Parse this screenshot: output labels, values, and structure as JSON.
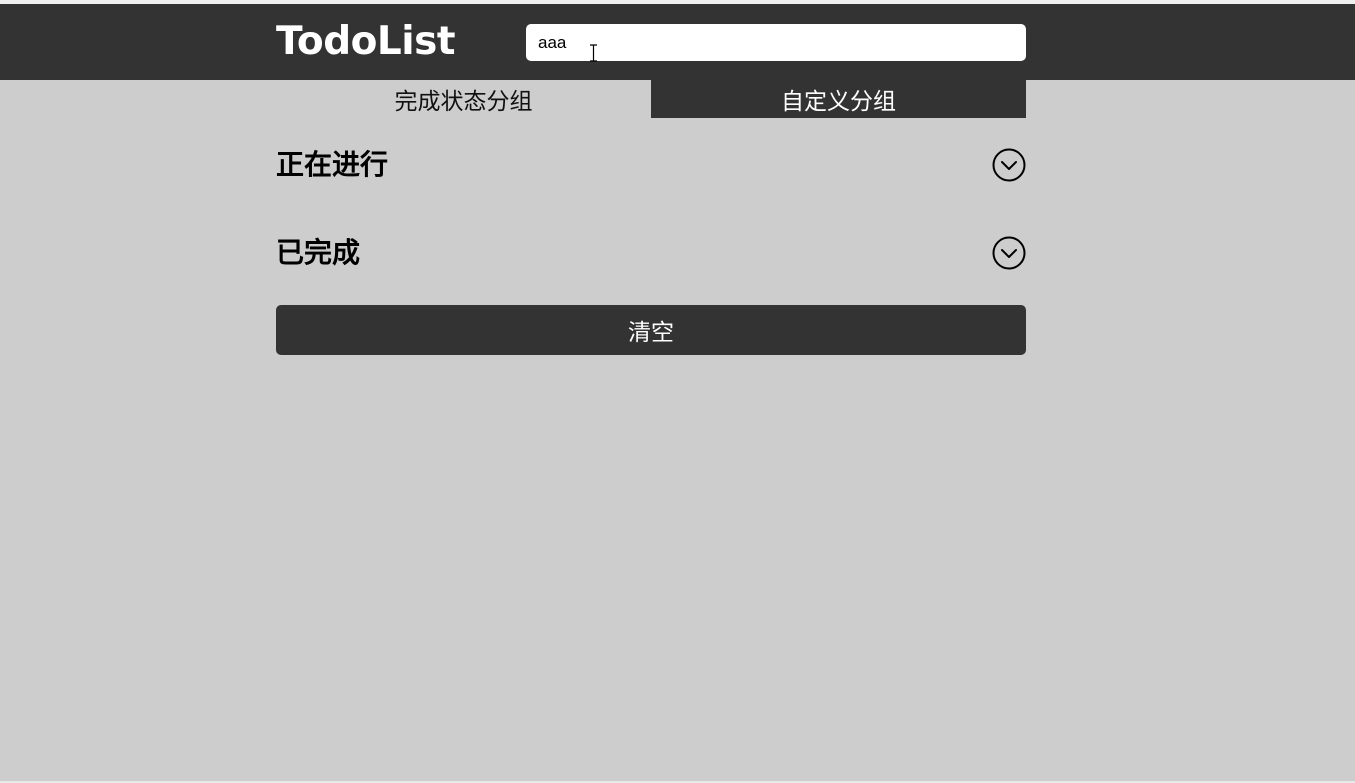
{
  "header": {
    "logo": "TodoList",
    "search": {
      "value": "aaa",
      "placeholder": ""
    }
  },
  "tabs": [
    {
      "label": "完成状态分组",
      "active": true
    },
    {
      "label": "自定义分组",
      "active": false
    }
  ],
  "sections": [
    {
      "title": "正在进行",
      "icon": "chevron-down-circle-icon"
    },
    {
      "title": "已完成",
      "icon": "chevron-down-circle-icon"
    }
  ],
  "actions": {
    "clear_label": "清空"
  },
  "colors": {
    "header_bg": "#333333",
    "page_bg": "#cdcdcd",
    "button_bg": "#333333",
    "text_light": "#ffffff",
    "text_dark": "#000000"
  }
}
